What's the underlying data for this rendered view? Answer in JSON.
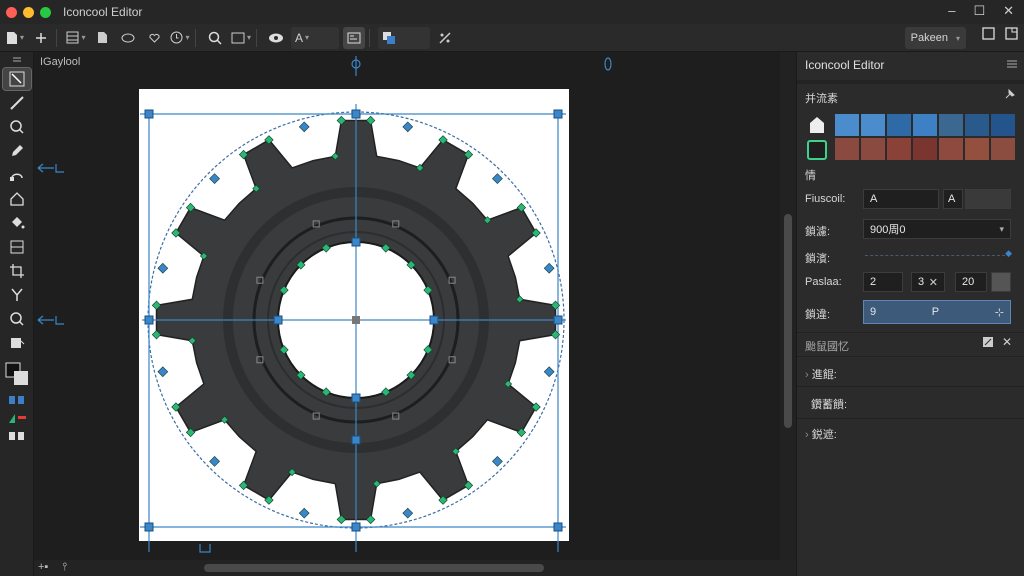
{
  "window": {
    "title": "Iconcool Editor",
    "controls": {
      "minimize": "–",
      "maximize": "☐",
      "close": "✕"
    }
  },
  "toolbar": {
    "zoom_value": "A",
    "profile_label": "Pakeen"
  },
  "document": {
    "tab_label": "IGaylool"
  },
  "tools": [
    "select",
    "pen",
    "zoom",
    "pencil",
    "node",
    "shape",
    "fill",
    "transform",
    "crop",
    "connector",
    "magnifier",
    "paint"
  ],
  "right_panel": {
    "title": "Iconcool Editor",
    "section_swatches": "并流素",
    "section_fill": "情",
    "swatch_colors": [
      "#4a8ccc",
      "#4a8ccc",
      "#2e6aa6",
      "#3d80c4",
      "#3a6890",
      "#2a5a8c",
      "#23558c",
      "#8a4a40",
      "#8b4a40",
      "#8a4238",
      "#7a3530",
      "#8f4a40",
      "#94503f",
      "#8b4d3f"
    ],
    "props": {
      "font_label": "Fiuscoil:",
      "font_value": "A",
      "font_btn": "A",
      "row2_label": "鎖濾:",
      "row2_value": "900周0",
      "row3_label": "鎖濱:",
      "row4_label": "Paslaa:",
      "row4_v1": "2",
      "row4_v2": "3",
      "row4_v3": "20",
      "row5_label": "鎖違:",
      "row5_v1": "9",
      "row5_v2": "P"
    },
    "section_lower": "颱鼠國忆",
    "tree": [
      "進餛:",
      "鑽蓄饋:",
      "鋭遮:"
    ]
  },
  "colors": {
    "accent": "#3d7fc6",
    "handle_green": "#2bb673",
    "handle_blue": "#3a86c8",
    "gear": "#3a3b3d"
  }
}
